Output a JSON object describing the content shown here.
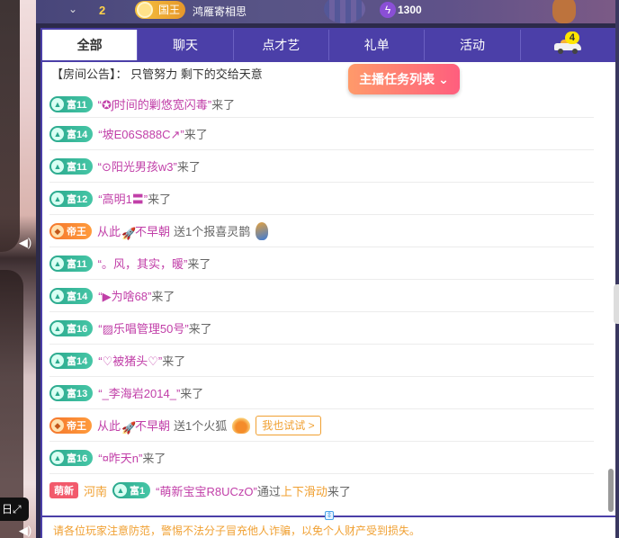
{
  "video": {
    "day_label": "日",
    "expand_icon": "expand-icon",
    "volume_icon": "volume-icon"
  },
  "topbar": {
    "level_number": "2",
    "rank_badge": "国王",
    "user_name": "鸿雁寄相思",
    "points": "1300"
  },
  "tabs": [
    {
      "label": "全部",
      "active": true
    },
    {
      "label": "聊天"
    },
    {
      "label": "点才艺"
    },
    {
      "label": "礼单"
    },
    {
      "label": "活动"
    },
    {
      "label": "",
      "icon": "car-icon",
      "count": "4"
    }
  ],
  "notice": {
    "label": "【房间公告】：",
    "text": "只管努力 剩下的交给天意"
  },
  "task_button": "主播任务列表",
  "messages": [
    {
      "badge": "富11",
      "name": "“✪ʃ时间的剿悠宽闪毒”",
      "suffix": "来了"
    },
    {
      "badge": "富14",
      "name": "“坡E06S888C↗”",
      "suffix": "来了"
    },
    {
      "badge": "富11",
      "name": "“⊙阳光男孩w3”",
      "suffix": "来了"
    },
    {
      "badge": "富12",
      "name": "“高明1〓”",
      "suffix": "来了"
    },
    {
      "badge": "帝王",
      "name_a": "从此",
      "name_b": "不早朝",
      "action": "送1个报喜灵鹊"
    },
    {
      "badge": "富11",
      "name": "“。风，其实，暖”",
      "suffix": "来了"
    },
    {
      "badge": "富14",
      "name": "“▶为啥68”",
      "suffix": "来了"
    },
    {
      "badge": "富16",
      "name": "“▨乐唱管理50号”",
      "suffix": "来了"
    },
    {
      "badge": "富14",
      "name": "“♡被猪头♡”",
      "suffix": "来了"
    },
    {
      "badge": "富13",
      "name": "“_李海岩2014_”",
      "suffix": "来了"
    },
    {
      "badge": "帝王",
      "name_a": "从此",
      "name_b": "不早朝",
      "action": "送1个火狐",
      "try_label": "我也试试 >"
    },
    {
      "badge": "富16",
      "name": "“¤昨天n”",
      "suffix": "来了"
    },
    {
      "tag": "萌新",
      "region": "河南",
      "badge": "富1",
      "name": "“萌新宝宝R8UCzO”",
      "via": "通过",
      "method": "上下滑动",
      "suffix": "来了"
    }
  ],
  "warning": "请各位玩家注意防范，警惕不法分子冒充他人诈骗，以免个人财产受到损失。"
}
